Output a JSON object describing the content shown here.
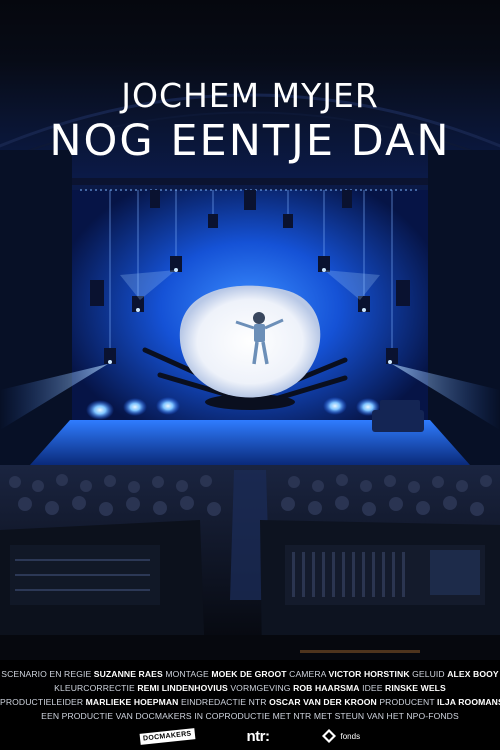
{
  "poster": {
    "title_line1": "JOCHEM MYJER",
    "title_line2": "NOG EENTJE DAN"
  },
  "credits": {
    "line1": [
      {
        "role": "SCENARIO EN REGIE",
        "name": "SUZANNE RAES"
      },
      {
        "role": "MONTAGE",
        "name": "MOEK DE GROOT"
      },
      {
        "role": "CAMERA",
        "name": "VICTOR HORSTINK"
      },
      {
        "role": "GELUID",
        "name": "ALEX BOOY"
      }
    ],
    "line2": [
      {
        "role": "KLEURCORRECTIE",
        "name": "REMI LINDENHOVIUS"
      },
      {
        "role": "VORMGEVING",
        "name": "ROB HAARSMA"
      },
      {
        "role": "IDEE",
        "name": "RINSKE WELS"
      }
    ],
    "line3": [
      {
        "role": "PRODUCTIELEIDER",
        "name": "MARLIEKE HOEPMAN"
      },
      {
        "role": "EINDREDACTIE NTR",
        "name": "OSCAR VAN DER KROON"
      },
      {
        "role": "PRODUCENT",
        "name": "ILJA ROOMANS"
      }
    ],
    "line4": "EEN PRODUCTIE VAN DOCMAKERS IN COPRODUCTIE MET NTR MET STEUN VAN HET NPO-FONDS"
  },
  "logos": {
    "docmakers": "DOCMAKERS",
    "ntr": "ntr:",
    "fonds": "fonds"
  },
  "colors": {
    "stage_blue": "#1e6bff",
    "light_blue": "#9fd0ff",
    "shell_white": "#f4f6fb"
  }
}
